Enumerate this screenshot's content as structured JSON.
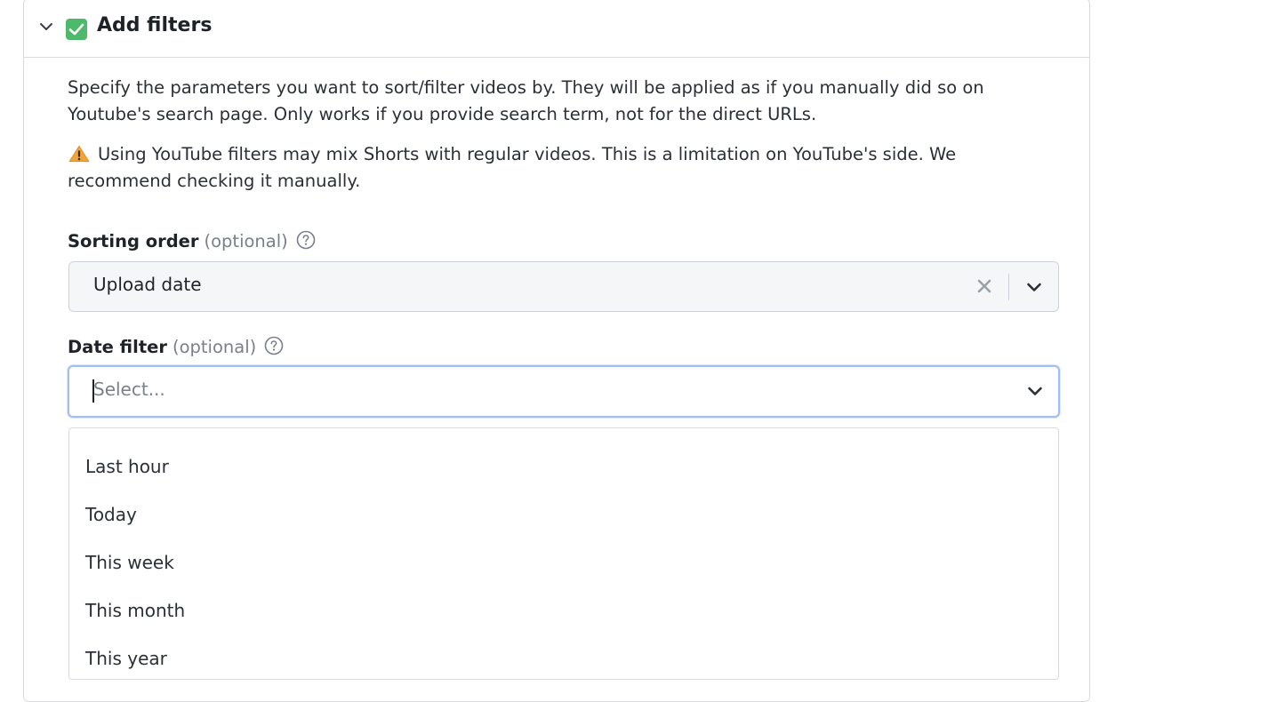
{
  "section": {
    "title": "Add filters",
    "description": "Specify the parameters you want to sort/filter videos by. They will be applied as if you manually did so on Youtube's search page. Only works if you provide search term, not for the direct URLs.",
    "warning": "Using YouTube filters may mix Shorts with regular videos. This is a limitation on YouTube's side. We recommend checking it manually.",
    "icons": {
      "toggle": "chevron-down-icon",
      "status": "check-icon",
      "warning": "warning-icon"
    }
  },
  "sorting_order": {
    "label": "Sorting order",
    "optional": "(optional)",
    "value": "Upload date"
  },
  "date_filter": {
    "label": "Date filter",
    "optional": "(optional)",
    "placeholder": "Select...",
    "options": [
      "Last hour",
      "Today",
      "This week",
      "This month",
      "This year"
    ]
  },
  "colors": {
    "accent_focus": "#a7bdf0",
    "check_green": "#4cba6a",
    "warning_orange": "#f2a33a"
  }
}
